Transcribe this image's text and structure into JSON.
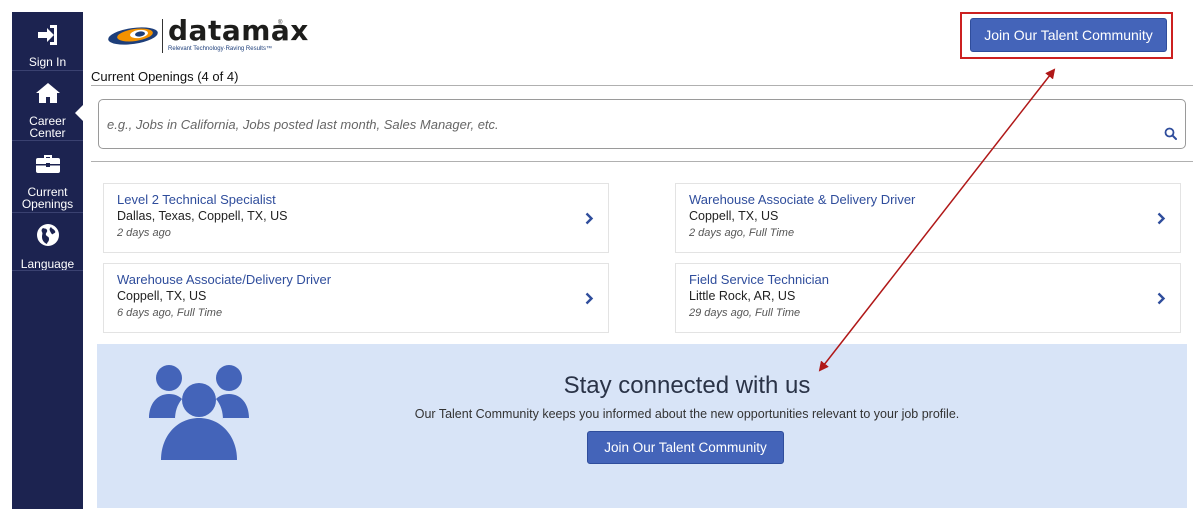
{
  "sidebar": {
    "items": [
      {
        "label": "Sign In",
        "icon": "sign-in-icon"
      },
      {
        "label": "Career Center",
        "icon": "home-icon"
      },
      {
        "label": "Current Openings",
        "icon": "briefcase-icon"
      },
      {
        "label": "Language",
        "icon": "globe-icon"
      }
    ]
  },
  "logo": {
    "wordmark": "datamax",
    "registered": "®",
    "tagline": "Relevant Technology·Raving Results™"
  },
  "header": {
    "join_button": "Join Our Talent Community"
  },
  "openings": {
    "title": "Current Openings (4 of 4)",
    "search_placeholder": "e.g., Jobs in California, Jobs posted last month, Sales Manager, etc."
  },
  "jobs": [
    {
      "title": "Level 2 Technical Specialist",
      "location": "Dallas, Texas, Coppell, TX, US",
      "meta": "2 days ago"
    },
    {
      "title": "Warehouse Associate & Delivery Driver",
      "location": "Coppell, TX, US",
      "meta": "2 days ago, Full Time"
    },
    {
      "title": "Warehouse Associate/Delivery Driver",
      "location": "Coppell, TX, US",
      "meta": "6 days ago, Full Time"
    },
    {
      "title": "Field Service Technician",
      "location": "Little Rock, AR, US",
      "meta": "29 days ago, Full Time"
    }
  ],
  "talent": {
    "heading": "Stay connected with us",
    "subtext": "Our Talent Community keeps you informed about the new opportunities relevant to your job profile.",
    "button": "Join Our Talent Community"
  },
  "colors": {
    "sidebar_bg": "#1c2350",
    "accent": "#4464b9",
    "panel_bg": "#d8e4f7",
    "annotation": "#cc2020"
  }
}
